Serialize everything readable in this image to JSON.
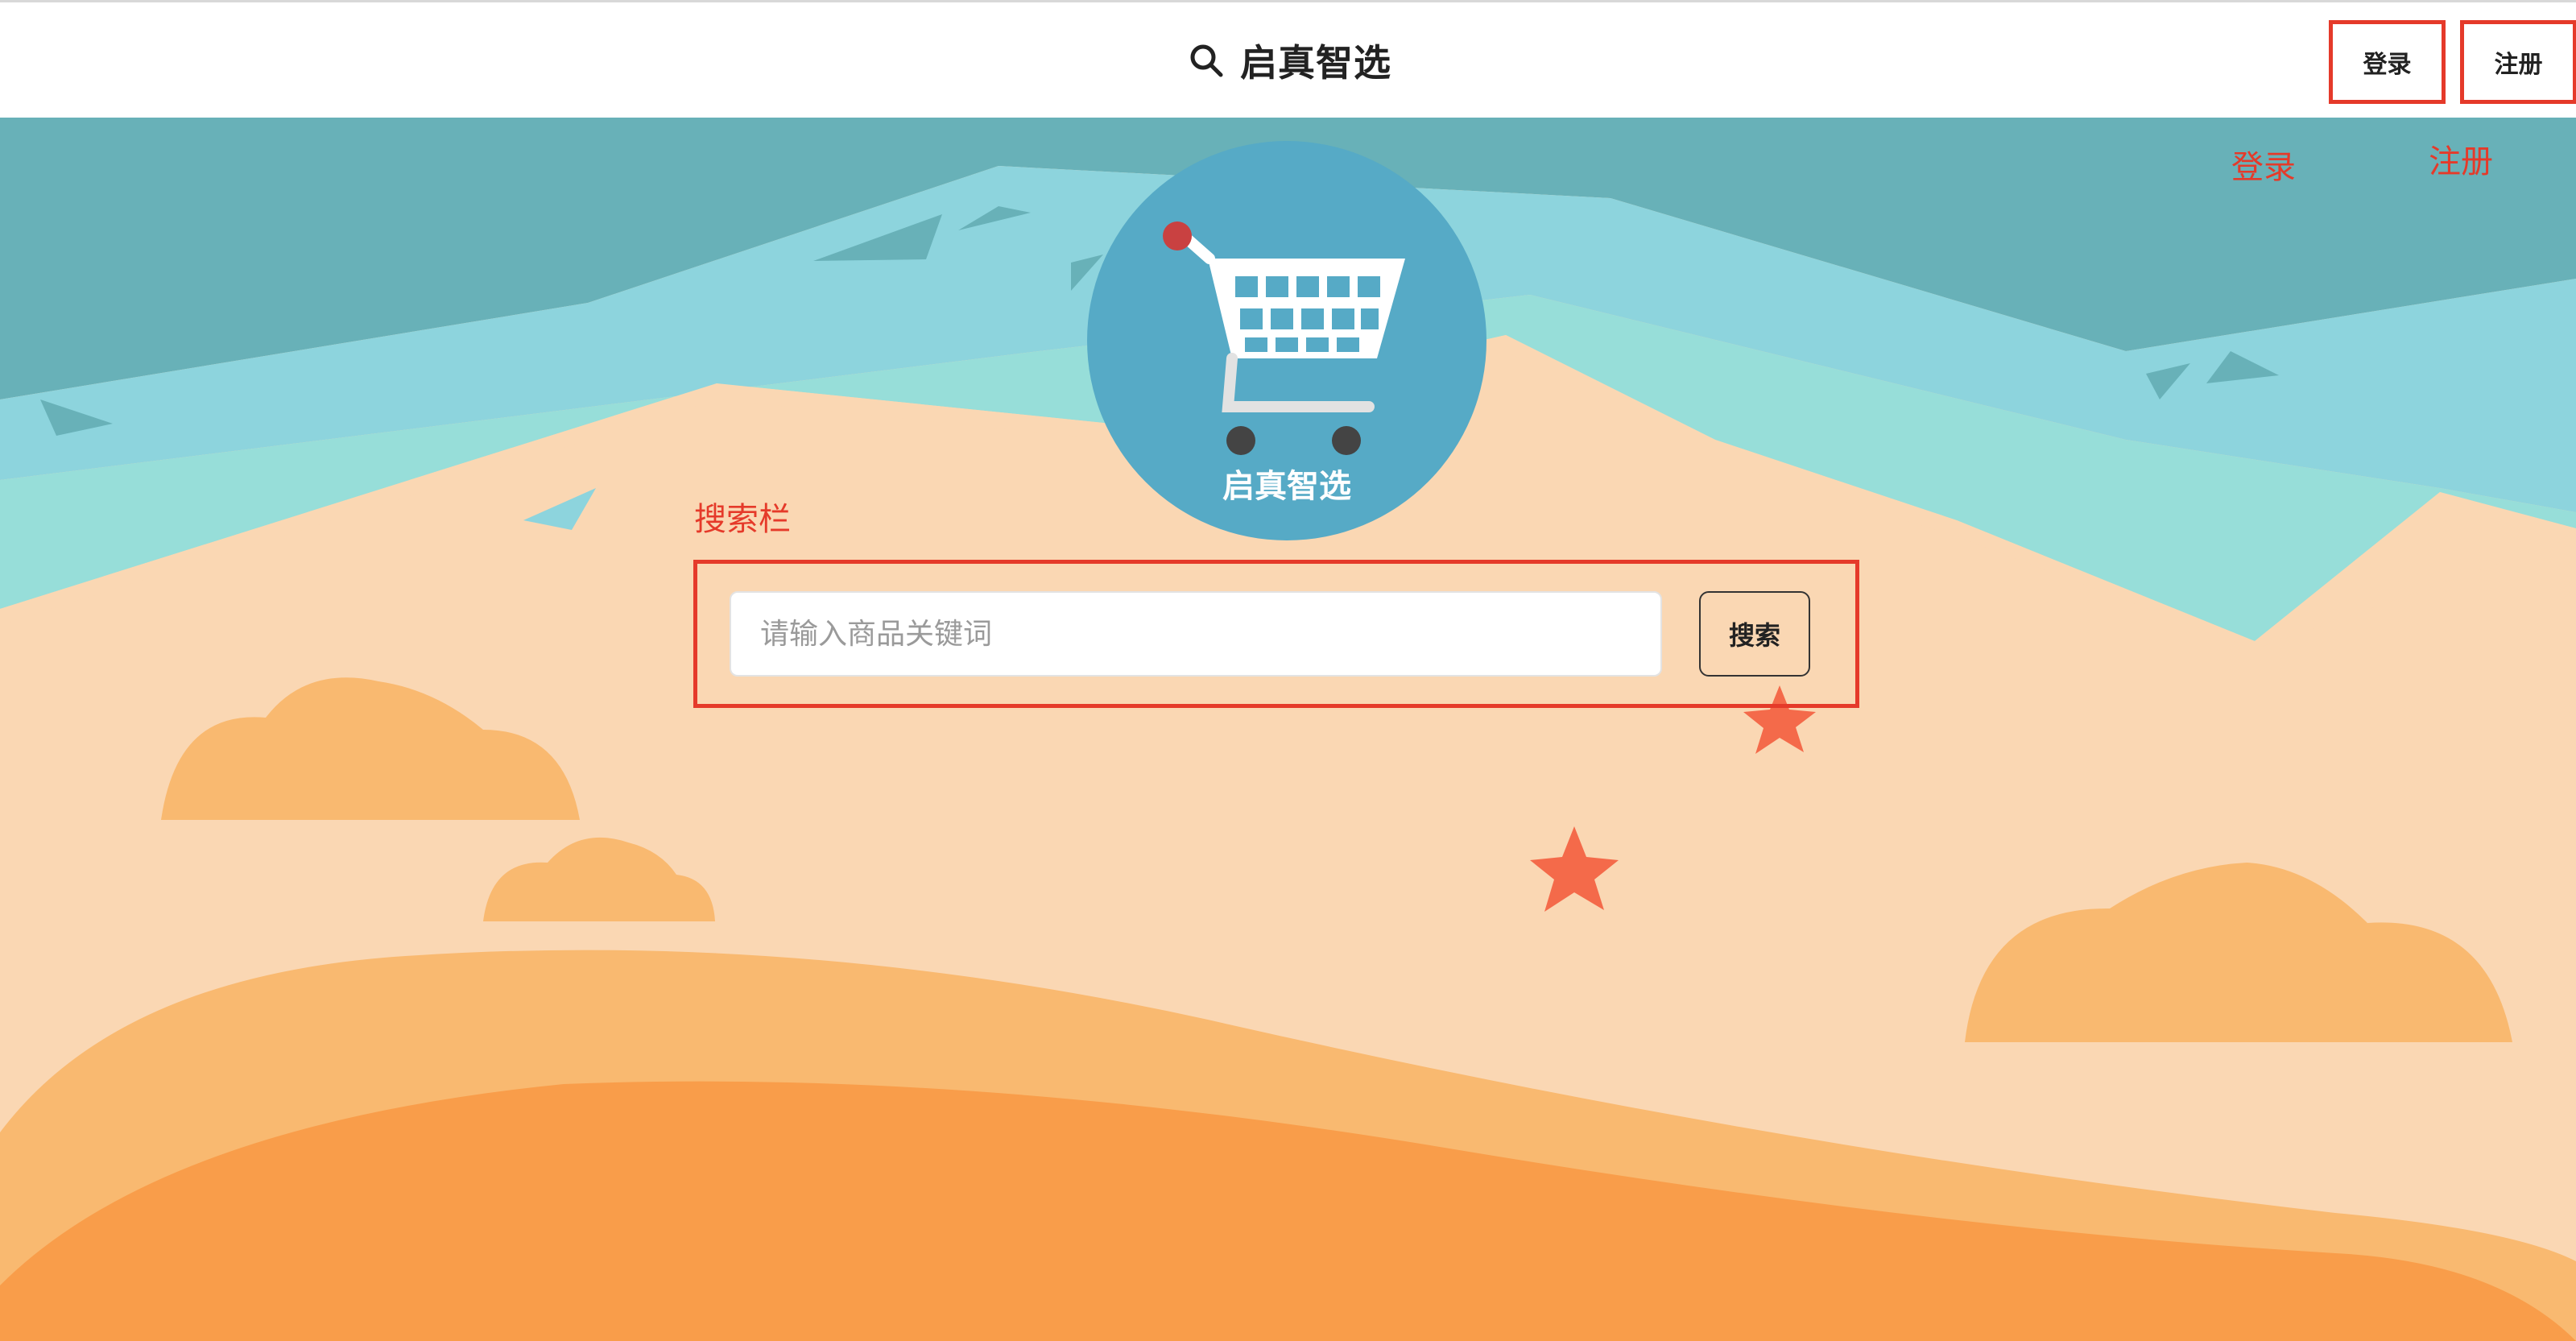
{
  "header": {
    "title": "启真智选",
    "login_label": "登录",
    "register_label": "注册"
  },
  "annotations": {
    "login": "登录",
    "register": "注册",
    "search_bar": "搜索栏"
  },
  "logo": {
    "text": "启真智选"
  },
  "search": {
    "placeholder": "请输入商品关键词",
    "button_label": "搜索"
  },
  "icons": {
    "header": "search-icon",
    "logo": "shopping-cart-icon"
  },
  "colors": {
    "annotation": "#e53a2a",
    "logo_circle": "#56aac6",
    "sand": "#fad7b3",
    "sea": "#8dd4dd",
    "deep_sea": "#68b1b8"
  }
}
